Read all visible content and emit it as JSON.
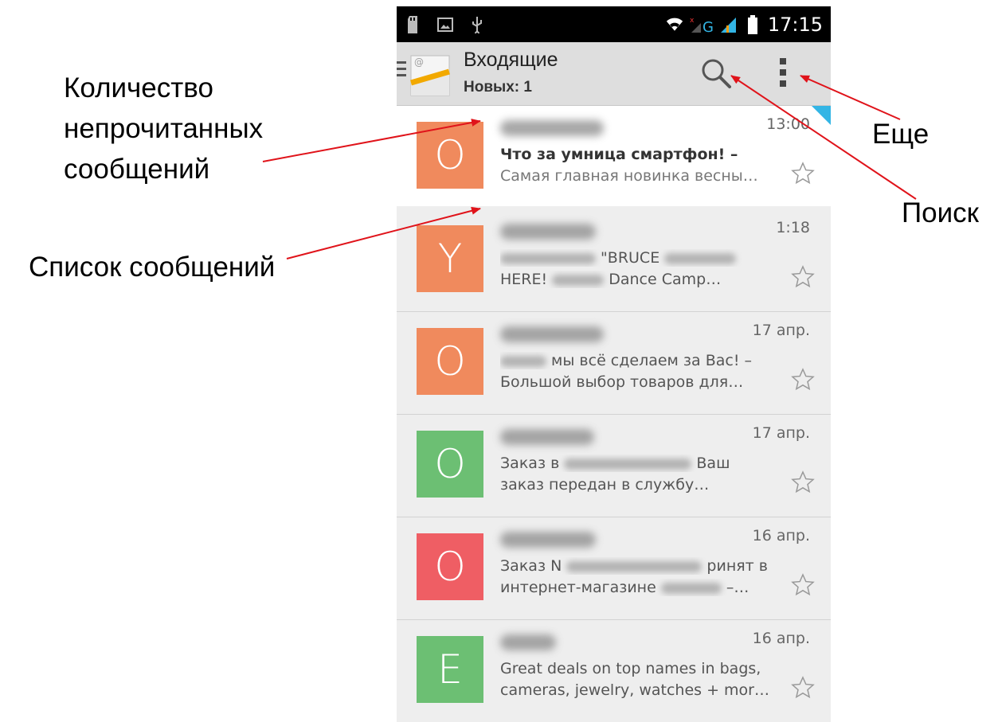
{
  "annotations": {
    "unread_count": "Количество\nнепрочитанных\nсообщений",
    "message_list": "Список сообщений",
    "more": "Еще",
    "search": "Поиск"
  },
  "statusbar": {
    "time": "17:15"
  },
  "actionbar": {
    "title": "Входящие",
    "subtitle": "Новых: 1"
  },
  "colors": {
    "orange": "#f08a5d",
    "green": "#6cbf73",
    "red": "#ef5e64",
    "unread_marker": "#33b5e5"
  },
  "messages": [
    {
      "avatar_letter": "О",
      "avatar_color": "#f08a5d",
      "date": "13:00",
      "subject_text": "Что за умница смартфон! –",
      "snippet_text": "Самая главная новинка весны…"
    },
    {
      "avatar_letter": "Y",
      "avatar_color": "#f08a5d",
      "date": "1:18",
      "subject_text": "\"BRUCE",
      "snippet_text_a": "HERE!",
      "snippet_text_b": "Dance Camp…"
    },
    {
      "avatar_letter": "О",
      "avatar_color": "#f08a5d",
      "date": "17 апр.",
      "subject_text": "мы всё сделаем за Вас! –",
      "snippet_text": "Большой выбор товаров для…"
    },
    {
      "avatar_letter": "О",
      "avatar_color": "#6cbf73",
      "date": "17 апр.",
      "subject_text_a": "Заказ в",
      "subject_text_b": "Ваш",
      "snippet_text": "заказ передан в службу…"
    },
    {
      "avatar_letter": "О",
      "avatar_color": "#ef5e64",
      "date": "16 апр.",
      "subject_text_a": "Заказ N",
      "subject_text_b": "ринят в",
      "snippet_text_a": "интернет-магазине",
      "snippet_text_b": "–…"
    },
    {
      "avatar_letter": "E",
      "avatar_color": "#6cbf73",
      "date": "16 апр.",
      "subject_text": "Great deals on top names in bags,",
      "snippet_text": "cameras, jewelry, watches + mor…"
    }
  ]
}
